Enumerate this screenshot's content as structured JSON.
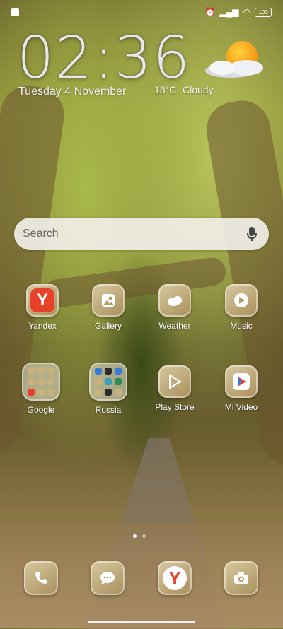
{
  "clock": {
    "time": "02:36",
    "date": "Tuesday 4 November"
  },
  "weather": {
    "temperature": "18°C",
    "condition": "Cloudy",
    "icon": "sun-behind-cloud-icon"
  },
  "status_bar": {
    "battery": "100"
  },
  "search": {
    "placeholder": "Search"
  },
  "apps": [
    {
      "label": "Yandex"
    },
    {
      "label": "Gallery"
    },
    {
      "label": "Weather"
    },
    {
      "label": "Music"
    },
    {
      "label": "Google"
    },
    {
      "label": "Russia"
    },
    {
      "label": "Play Store"
    },
    {
      "label": "Mi Video"
    }
  ],
  "dock": [
    "phone-icon",
    "messages-icon",
    "yandex-browser-icon",
    "camera-icon"
  ],
  "colors": {
    "yandex_red": "#e8412a",
    "tile_gold": "#c7b27d"
  }
}
